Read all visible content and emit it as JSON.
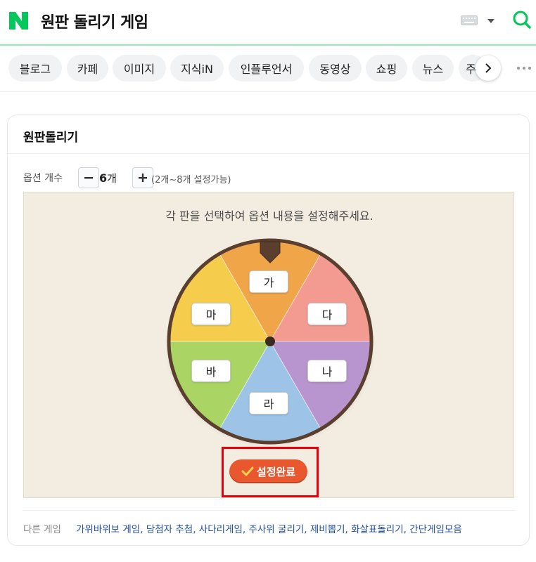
{
  "header": {
    "logo_letter": "N",
    "query": "원판 돌리기 게임"
  },
  "tabs": [
    {
      "label": "블로그"
    },
    {
      "label": "카페"
    },
    {
      "label": "이미지"
    },
    {
      "label": "지식iN"
    },
    {
      "label": "인플루언서"
    },
    {
      "label": "동영상"
    },
    {
      "label": "쇼핑"
    },
    {
      "label": "뉴스"
    },
    {
      "label": "주"
    }
  ],
  "card": {
    "title": "원판돌리기",
    "option": {
      "label": "옵션 개수",
      "count": "6",
      "unit": "개",
      "range_note": "(2개~8개 설정가능)"
    },
    "instruction": "각 판을 선택하여 옵션 내용을 설정해주세요.",
    "wheel": {
      "segments": [
        {
          "label": "가",
          "color": "#f0a648"
        },
        {
          "label": "다",
          "color": "#f39b90"
        },
        {
          "label": "나",
          "color": "#b995cf"
        },
        {
          "label": "라",
          "color": "#9dc3e6"
        },
        {
          "label": "바",
          "color": "#aad564"
        },
        {
          "label": "마",
          "color": "#f6cc4c"
        }
      ],
      "rim_color": "#5a3f2f"
    },
    "done_button": "설정완료",
    "other_games": {
      "label": "다른 게임",
      "links": "가위바위보 게임, 당첨자 추첨, 사다리게임, 주사위 굴리기, 제비뽑기, 화살표돌리기, 간단게임모음"
    }
  },
  "colors": {
    "brand": "#03c75a",
    "highlight": "#e8000c",
    "button": "#e9572f",
    "link": "#2050a0"
  }
}
